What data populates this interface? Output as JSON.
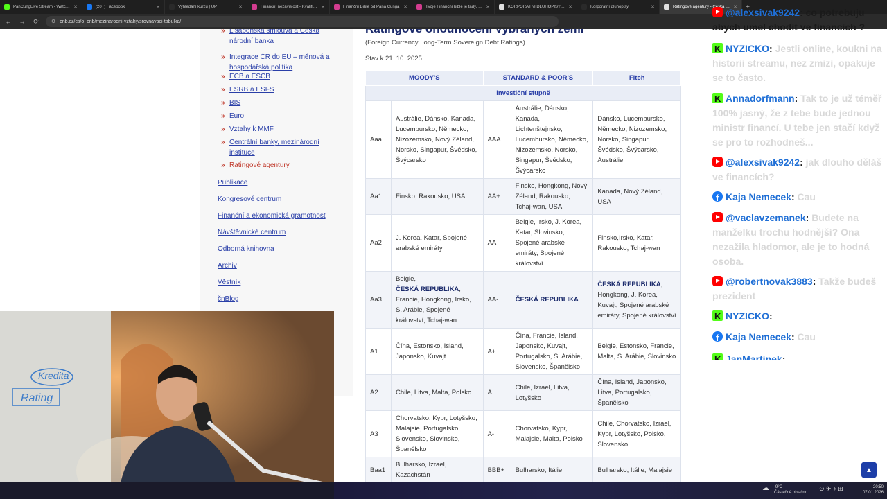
{
  "browser": {
    "tabs": [
      {
        "title": "PanCungLive Stream - Watch Li",
        "color": "#53fc18",
        "active": false
      },
      {
        "title": "(20+) Facebook",
        "color": "#1877f2",
        "active": false
      },
      {
        "title": "Vyhledání kurzu | ÚP",
        "color": "#2a2a2a",
        "active": false
      },
      {
        "title": "Finanční nezávislost - Kvalifikac",
        "color": "#d33c8f",
        "active": false
      },
      {
        "title": "Finanční Bible od Pana Čunga",
        "color": "#d33c8f",
        "active": false
      },
      {
        "title": "Tvoje Finanční bible je tady, Pa",
        "color": "#d33c8f",
        "active": false
      },
      {
        "title": "KORPORÁTNÍ DLUHOPISY - Hle",
        "color": "#e0e0e0",
        "active": false
      },
      {
        "title": "Korporátní dluhopisy",
        "color": "#2a2a2a",
        "active": false
      },
      {
        "title": "Ratingové agentury - Česká ná",
        "color": "#e0e0e0",
        "active": true
      }
    ],
    "url": "cnb.cz/cs/o_cnb/mezinarodni-vztahy/srovnavaci-tabulka/"
  },
  "sidebar": {
    "sub_items": [
      {
        "label": "Lisabonská smlouva a Česká národní banka",
        "line1": "Lisabonská smlouva a Česká",
        "line2": "národní banka"
      },
      {
        "label": "Integrace ČR do EU – měnová a hospodářská politika",
        "line1": "Integrace ČR do EU – měnová a",
        "line2": "hospodářská politika"
      },
      {
        "label": "ECB a ESCB"
      },
      {
        "label": "ESRB a ESFS"
      },
      {
        "label": "BIS"
      },
      {
        "label": "Euro"
      },
      {
        "label": "Vztahy k MMF"
      },
      {
        "label": "Centrální banky, mezinárodní instituce",
        "line1": "Centrální banky, mezinárodní",
        "line2": "instituce"
      },
      {
        "label": "Ratingové agentury"
      }
    ],
    "nav_items": [
      "Publikace",
      "Kongresové centrum",
      "Finanční a ekonomická gramotnost",
      "Návštěvnické centrum",
      "Odborná knihovna",
      "Archiv",
      "Věstník",
      "čnBlog"
    ]
  },
  "main": {
    "heading": "Ratingové ohodnocení vybraných zemí",
    "subtitle": "(Foreign Currency Long-Term Sovereign Debt Ratings)",
    "as_of": "Stav k 21. 10. 2025",
    "columns": [
      "MOODY'S",
      "STANDARD & POOR'S",
      "Fitch"
    ],
    "section": "Investiční stupně",
    "rows": [
      {
        "m_code": "Aaa",
        "m_list": "Austrálie, Dánsko, Kanada, Lucembursko, Německo, Nizozemsko, Nový Zéland, Norsko, Singapur, Švédsko, Švýcarsko",
        "s_code": "AAA",
        "s_list": "Austrálie, Dánsko, Kanada, Lichtenštejnsko, Lucembursko, Německo, Nizozemsko, Norsko,  Singapur, Švédsko, Švýcarsko",
        "f_list": "Dánsko, Lucembursko, Německo, Nizozemsko, Norsko, Singapur, Švédsko, Švýcarsko, Austrálie"
      },
      {
        "m_code": "Aa1",
        "m_list": "Finsko, Rakousko, USA",
        "s_code": "AA+",
        "s_list": "Finsko, Hongkong, Nový Zéland, Rakousko, Tchaj-wan, USA",
        "f_list": "Kanada, Nový Zéland, USA"
      },
      {
        "m_code": "Aa2",
        "m_list": "J. Korea, Katar, Spojené arabské emiráty",
        "s_code": "AA",
        "s_list": "Belgie, Irsko, J. Korea, Katar, Slovinsko, Spojené arabské emiráty, Spojené království",
        "f_list": "Finsko,Irsko, Katar, Rakousko, Tchaj-wan"
      },
      {
        "m_code": "Aa3",
        "m_list_pre": "Belgie,",
        "m_list_cz": "ČESKÁ REPUBLIKA",
        "m_list_post": ", Francie, Hongkong, Irsko, S. Arábie, Spojené království, Tchaj-wan",
        "s_code": "AA-",
        "s_list_cz": "ČESKÁ REPUBLIKA",
        "f_list_cz": "ČESKÁ REPUBLIKA",
        "f_list_post": ", Hongkong, J. Korea, Kuvajt, Spojené arabské emiráty, Spojené království"
      },
      {
        "m_code": "A1",
        "m_list": "Čína, Estonsko, Island, Japonsko, Kuvajt",
        "s_code": "A+",
        "s_list": "Čína, Francie, Island, Japonsko, Kuvajt, Portugalsko, S. Arábie, Slovensko, Španělsko",
        "f_list": "Belgie, Estonsko, Francie, Malta, S. Arábie, Slovinsko"
      },
      {
        "m_code": "A2",
        "m_list": "Chile, Litva, Malta, Polsko",
        "s_code": "A",
        "s_list": "Chile, Izrael, Litva, Lotyšsko",
        "f_list": "Čína, Island, Japonsko, Litva, Portugalsko, Španělsko"
      },
      {
        "m_code": "A3",
        "m_list": "Chorvatsko, Kypr, Lotyšsko, Malajsie, Portugalsko, Slovensko, Slovinsko, Španělsko",
        "s_code": "A-",
        "s_list": "Chorvatsko, Kypr, Malajsie, Malta, Polsko",
        "f_list": "Chile, Chorvatsko, Izrael, Kypr, Lotyšsko, Polsko, Slovensko"
      },
      {
        "m_code": "Baa1",
        "m_list": "Bulharsko, Izrael, Kazachstán",
        "s_code": "BBB+",
        "s_list": "Bulharsko, Itálie",
        "f_list": "Bulharsko, Itálie, Malajsie"
      }
    ]
  },
  "chat": [
    {
      "platform": "yt",
      "user": "@alexsivak9242",
      "text": "co potrebuju abych umel chodit ve financich ?",
      "dark": true
    },
    {
      "platform": "kick",
      "user": "NYZICKO",
      "text": "Jestli online, koukni na historii streamu, nez zmizi, opakuje se to často."
    },
    {
      "platform": "kick",
      "user": "Annadorfmann",
      "text": "Tak to je už téměř 100% jasný, že z tebe bude jednou ministr financí. U tebe jen stačí když se pro to rozhodneš..."
    },
    {
      "platform": "yt",
      "user": "@alexsivak9242",
      "text": "jak dlouho děláš ve financích?"
    },
    {
      "platform": "fb",
      "user": "Kaja Nemecek",
      "text": "Cau"
    },
    {
      "platform": "yt",
      "user": "@vaclavzemanek",
      "text": "Budete na manželku trochu hodnější? Ona nezažila hladomor, ale je to hodná osoba."
    },
    {
      "platform": "yt",
      "user": "@robertnovak3883",
      "text": "Takže budeš prezident"
    },
    {
      "platform": "kick",
      "user": "NYZICKO",
      "text": ""
    },
    {
      "platform": "fb",
      "user": "Kaja Nemecek",
      "text": "Cau"
    },
    {
      "platform": "kick",
      "user": "JanMartinek",
      "text": "..."
    }
  ],
  "webcam": {
    "board_words": [
      "Kredita",
      "Rating"
    ]
  },
  "taskbar": {
    "weather_temp": "-9°C",
    "weather_text": "Částečně oblačno",
    "time": "20:50",
    "date": "07.01.2026"
  }
}
